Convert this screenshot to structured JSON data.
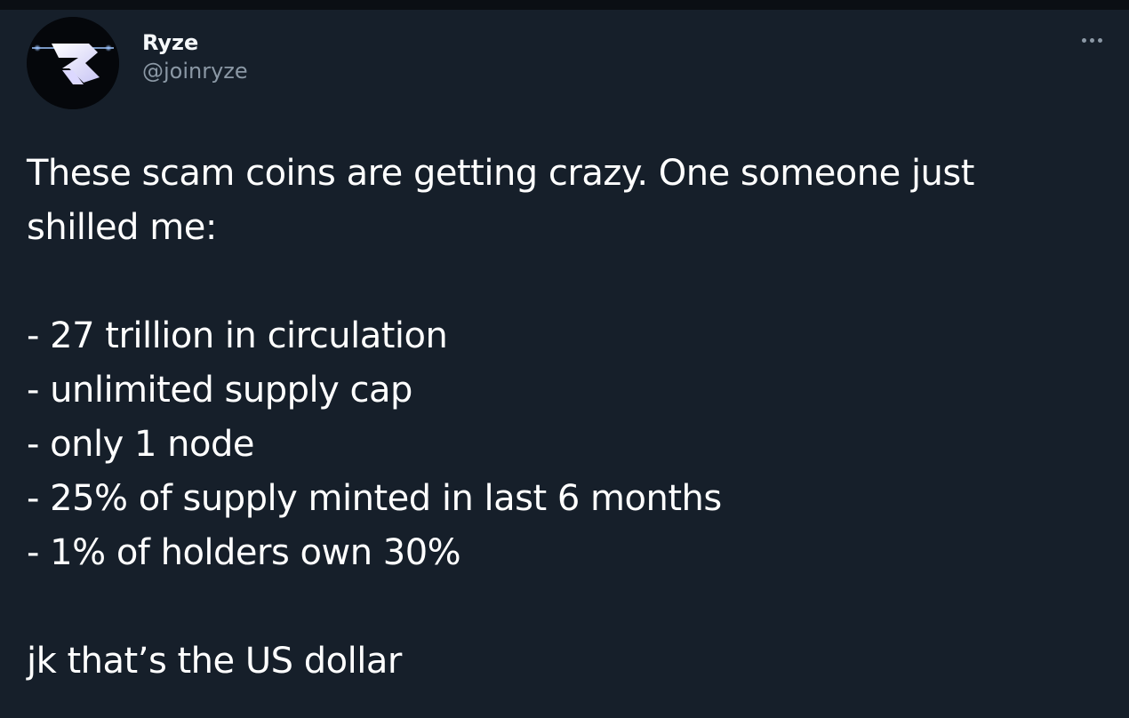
{
  "author": {
    "display_name": "Ryze",
    "handle": "@joinryze"
  },
  "icons": {
    "avatar": "ryze-logo-icon",
    "more": "more-options-icon"
  },
  "colors": {
    "background": "#161f2a",
    "text": "#ffffff",
    "secondary_text": "#8b98a5"
  },
  "tweet": {
    "intro_lines": [
      "These scam coins are getting crazy. One someone just",
      "shilled me:"
    ],
    "bullets": [
      "- 27 trillion in circulation",
      "- unlimited supply cap",
      "- only 1 node",
      "- 25% of supply minted in last 6 months",
      "- 1% of holders own 30%"
    ],
    "punchline": "jk that’s the US dollar"
  }
}
